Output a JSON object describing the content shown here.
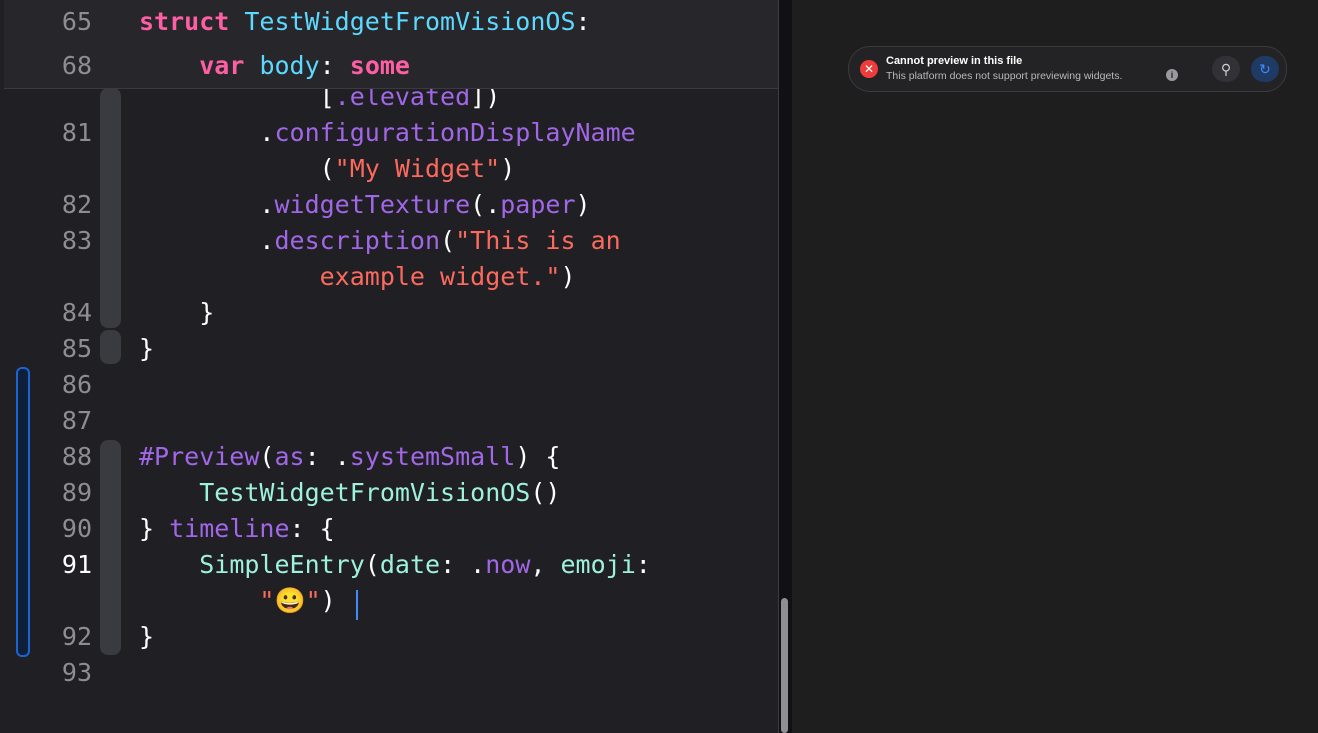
{
  "editor": {
    "sticky_headers": [
      {
        "line": "65",
        "tokens": [
          {
            "t": "struct",
            "c": "kw"
          },
          {
            "t": " ",
            "c": "plain"
          },
          {
            "t": "TestWidgetFromVisionOS",
            "c": "type"
          },
          {
            "t": ":",
            "c": "plain"
          }
        ]
      },
      {
        "line": "68",
        "tokens": [
          {
            "t": "    ",
            "c": "plain"
          },
          {
            "t": "var",
            "c": "kw"
          },
          {
            "t": " ",
            "c": "plain"
          },
          {
            "t": "body",
            "c": "type"
          },
          {
            "t": ": ",
            "c": "plain"
          },
          {
            "t": "some",
            "c": "kw"
          }
        ]
      }
    ],
    "lines": [
      {
        "line": "",
        "tokens": [
          {
            "t": "            [",
            "c": "plain"
          },
          {
            "t": ".elevated",
            "c": "prop"
          },
          {
            "t": "])",
            "c": "plain"
          }
        ]
      },
      {
        "line": "81",
        "tokens": [
          {
            "t": "        .",
            "c": "plain"
          },
          {
            "t": "configurationDisplayName",
            "c": "prop"
          }
        ]
      },
      {
        "line": "",
        "tokens": [
          {
            "t": "            (",
            "c": "plain"
          },
          {
            "t": "\"My Widget\"",
            "c": "str"
          },
          {
            "t": ")",
            "c": "plain"
          }
        ]
      },
      {
        "line": "82",
        "tokens": [
          {
            "t": "        .",
            "c": "plain"
          },
          {
            "t": "widgetTexture",
            "c": "prop"
          },
          {
            "t": "(.",
            "c": "plain"
          },
          {
            "t": "paper",
            "c": "prop"
          },
          {
            "t": ")",
            "c": "plain"
          }
        ]
      },
      {
        "line": "83",
        "tokens": [
          {
            "t": "        .",
            "c": "plain"
          },
          {
            "t": "description",
            "c": "prop"
          },
          {
            "t": "(",
            "c": "plain"
          },
          {
            "t": "\"This is an",
            "c": "str"
          }
        ]
      },
      {
        "line": "",
        "tokens": [
          {
            "t": "            ",
            "c": "plain"
          },
          {
            "t": "example widget.\"",
            "c": "str"
          },
          {
            "t": ")",
            "c": "plain"
          }
        ]
      },
      {
        "line": "84",
        "tokens": [
          {
            "t": "    }",
            "c": "plain"
          }
        ]
      },
      {
        "line": "85",
        "tokens": [
          {
            "t": "}",
            "c": "plain"
          }
        ]
      },
      {
        "line": "86",
        "tokens": []
      },
      {
        "line": "87",
        "tokens": []
      },
      {
        "line": "88",
        "tokens": [
          {
            "t": "#Preview",
            "c": "prop"
          },
          {
            "t": "(",
            "c": "plain"
          },
          {
            "t": "as",
            "c": "prop"
          },
          {
            "t": ": .",
            "c": "plain"
          },
          {
            "t": "systemSmall",
            "c": "prop"
          },
          {
            "t": ") {",
            "c": "plain"
          }
        ]
      },
      {
        "line": "89",
        "tokens": [
          {
            "t": "    ",
            "c": "plain"
          },
          {
            "t": "TestWidgetFromVisionOS",
            "c": "mint"
          },
          {
            "t": "()",
            "c": "plain"
          }
        ]
      },
      {
        "line": "90",
        "tokens": [
          {
            "t": "} ",
            "c": "plain"
          },
          {
            "t": "timeline",
            "c": "prop"
          },
          {
            "t": ": {",
            "c": "plain"
          }
        ]
      },
      {
        "line": "91",
        "current": true,
        "tokens": [
          {
            "t": "    ",
            "c": "plain"
          },
          {
            "t": "SimpleEntry",
            "c": "mint"
          },
          {
            "t": "(",
            "c": "plain"
          },
          {
            "t": "date",
            "c": "mint"
          },
          {
            "t": ": .",
            "c": "plain"
          },
          {
            "t": "now",
            "c": "prop"
          },
          {
            "t": ", ",
            "c": "plain"
          },
          {
            "t": "emoji",
            "c": "mint"
          },
          {
            "t": ":",
            "c": "plain"
          }
        ]
      },
      {
        "line": "",
        "current": true,
        "tokens": [
          {
            "t": "        ",
            "c": "plain"
          },
          {
            "t": "\"😀\"",
            "c": "str"
          },
          {
            "t": ")",
            "c": "plain"
          }
        ]
      },
      {
        "line": "92",
        "tokens": [
          {
            "t": "}",
            "c": "plain"
          }
        ]
      },
      {
        "line": "93",
        "tokens": []
      }
    ]
  },
  "preview": {
    "error_icon": "xmark-circle-icon",
    "title": "Cannot preview in this file",
    "message": "This platform does not support previewing widgets.",
    "info_icon": "info-circle-icon",
    "buttons": [
      {
        "name": "pin-preview-button",
        "icon": "pin-icon",
        "glyph": "⚲",
        "active": false
      },
      {
        "name": "refresh-preview-button",
        "icon": "refresh-icon",
        "glyph": "↻",
        "active": true
      }
    ]
  },
  "colors": {
    "keyword": "#fc5fa3",
    "type": "#5dd8ff",
    "property": "#a167e6",
    "string": "#fc6a5d",
    "accent": "#3f8cff",
    "error": "#ec3d3a"
  }
}
